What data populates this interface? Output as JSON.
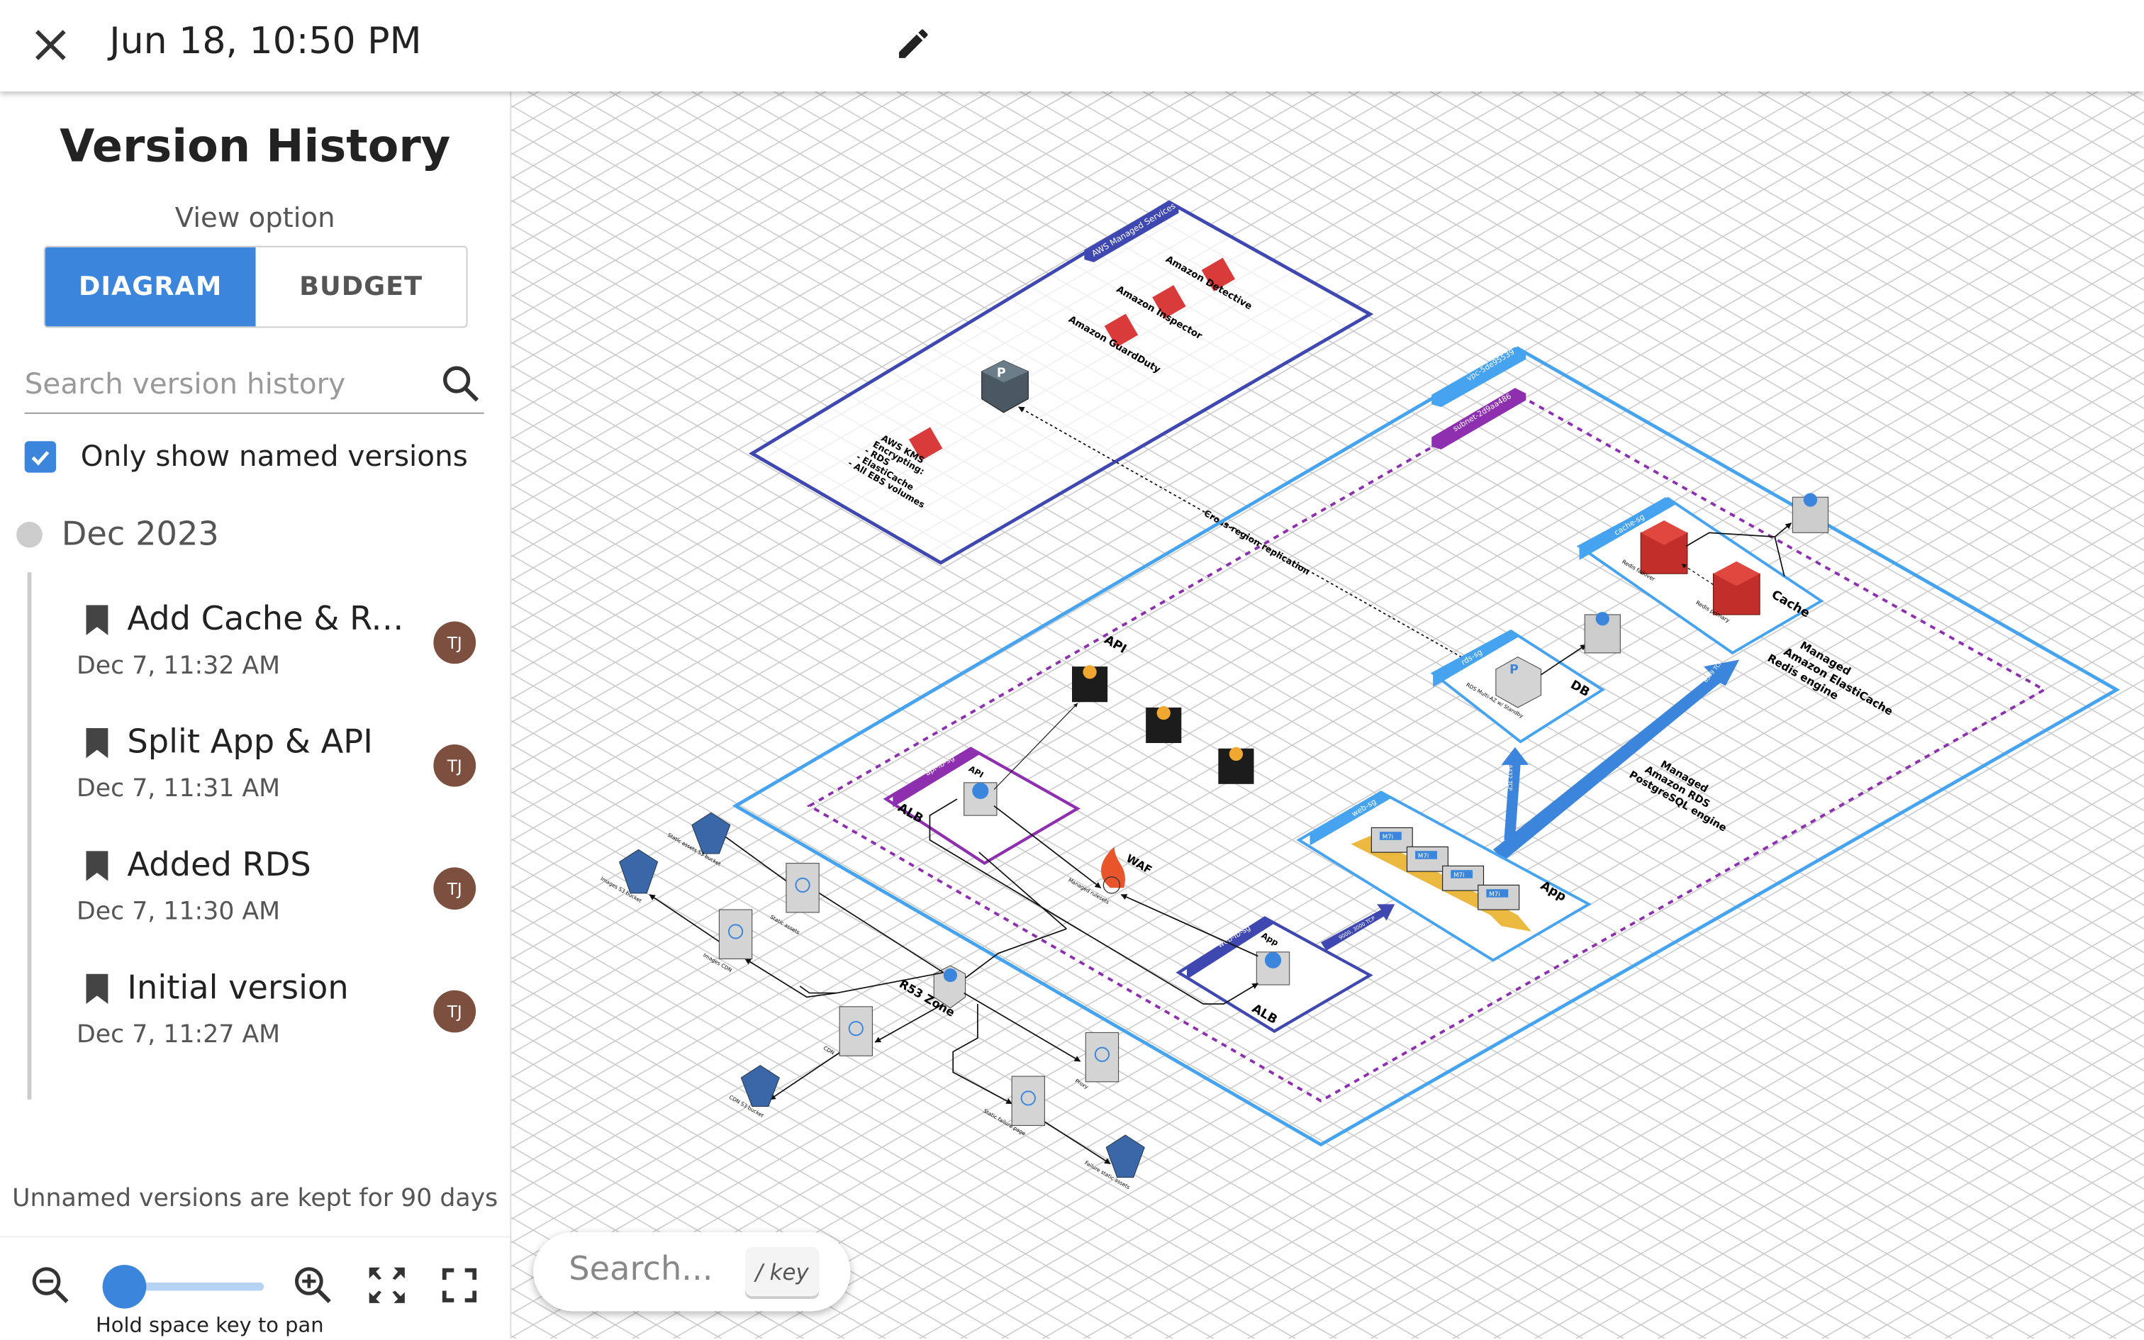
{
  "header": {
    "title": "Jun 18, 10:50 PM",
    "close_icon": "close-icon",
    "edit_icon": "pencil-icon"
  },
  "sidebar": {
    "title": "Version History",
    "view_option_label": "View option",
    "view_options": [
      {
        "label": "DIAGRAM",
        "selected": true
      },
      {
        "label": "BUDGET",
        "selected": false
      }
    ],
    "search_placeholder": "Search version history",
    "only_named_label": "Only show named versions",
    "only_named_checked": true,
    "month": "Dec 2023",
    "versions": [
      {
        "name": "Add Cache & Re...",
        "date": "Dec 7, 11:32 AM",
        "avatar": "TJ"
      },
      {
        "name": "Split App & API",
        "date": "Dec 7, 11:31 AM",
        "avatar": "TJ"
      },
      {
        "name": "Added RDS",
        "date": "Dec 7, 11:30 AM",
        "avatar": "TJ"
      },
      {
        "name": "Initial version",
        "date": "Dec 7, 11:27 AM",
        "avatar": "TJ"
      }
    ],
    "note": "Unnamed versions are kept for 90 days",
    "zoom_level": 0,
    "pan_hint": "Hold space key to pan"
  },
  "canvas_search": {
    "placeholder": "Search...",
    "shortcut": "/ key"
  },
  "colors": {
    "accent": "#3b86dc",
    "avatar": "#7d4f3f",
    "managed_services": "#3f48b0",
    "vpc": "#45a3ef",
    "subnet": "#8e2fb0",
    "security": "#d93a3a"
  },
  "diagram": {
    "managed_services": "AWS Managed Services",
    "detective": "Amazon Detective",
    "inspector": "Amazon Inspector",
    "guardduty": "Amazon GuardDuty",
    "kms": [
      "AWS KMS",
      "Encrypting:",
      "- RDS",
      "- ElastiCache",
      "- All EBS volumes"
    ],
    "replication": "Cross-region replication",
    "vpc": "vpc-5de95539",
    "subnet": "subnet-2d9aa486",
    "cache_sg": "cache-sg",
    "redis_failover": "Redis failover",
    "redis_primary": "Redis primary",
    "cache": "Cache",
    "elasticache": [
      "Managed",
      "Amazon ElastiCache",
      "Redis engine"
    ],
    "rds_sg": "rds-sg",
    "rds": "RDS Multi-AZ w/ Standby",
    "db": "DB",
    "rds_engine": [
      "Managed",
      "Amazon RDS",
      "PostgreSQL engine"
    ],
    "port_pg": "5432 TCP",
    "port_redis": "6379 TCP",
    "api": "API",
    "api_lb_sg": "api-lb-sg",
    "api_alb_node": "API",
    "alb": "ALB",
    "waf": "WAF",
    "managed_rulesets": "Managed rulesets",
    "web_lb_sg": "web-lb-sg",
    "app_alb_node": "App",
    "web_sg": "web-sg",
    "instance": "M7i",
    "app": "App",
    "port_web": "9000, 3000 TCP",
    "r53": "R53 Zone",
    "static_s3": "Static assets S3 bucket",
    "images_s3": "Images S3 bucket",
    "static_assets": "Static assets",
    "images_cdn": "Images CDN",
    "cdn": "CDN",
    "cdn_s3": "CDN S3 bucket",
    "proxy": "Proxy",
    "failure_page": "Static failure page",
    "failure_assets": "Failure static assets"
  }
}
